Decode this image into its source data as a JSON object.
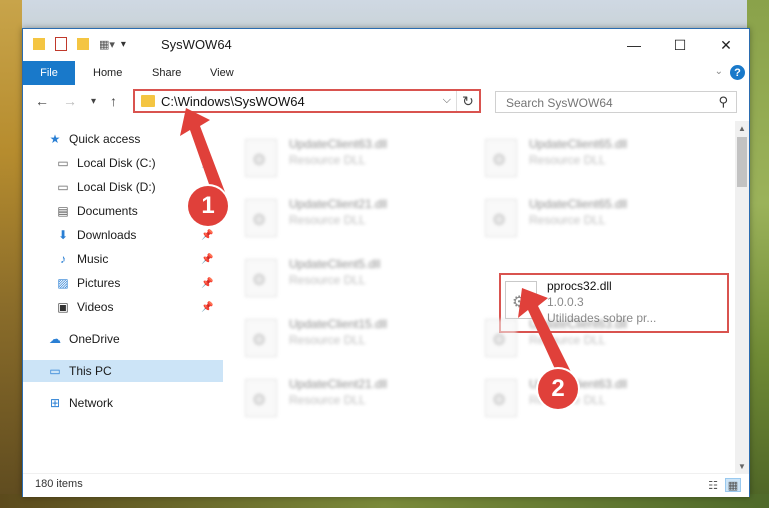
{
  "window": {
    "title": "SysWOW64",
    "minimize": "—",
    "maximize": "☐",
    "close": "✕"
  },
  "ribbon": {
    "file": "File",
    "home": "Home",
    "share": "Share",
    "view": "View",
    "help": "?"
  },
  "nav": {
    "back": "←",
    "forward": "→",
    "recent": "▾",
    "up": "↑",
    "address": "C:\\Windows\\SysWOW64",
    "dropdown": "⌵",
    "refresh": "↻",
    "search_placeholder": "Search SysWOW64",
    "search_icon": "⚲"
  },
  "sidebar": {
    "items": [
      {
        "label": "Quick access",
        "icon": "star-icon"
      },
      {
        "label": "Local Disk (C:)",
        "icon": "drive-icon"
      },
      {
        "label": "Local Disk (D:)",
        "icon": "drive-icon"
      },
      {
        "label": "Documents",
        "icon": "documents-icon"
      },
      {
        "label": "Downloads",
        "icon": "download-icon"
      },
      {
        "label": "Music",
        "icon": "music-icon"
      },
      {
        "label": "Pictures",
        "icon": "pictures-icon"
      },
      {
        "label": "Videos",
        "icon": "videos-icon"
      },
      {
        "label": "OneDrive",
        "icon": "cloud-icon"
      },
      {
        "label": "This PC",
        "icon": "computer-icon"
      },
      {
        "label": "Network",
        "icon": "network-icon"
      }
    ]
  },
  "files": [
    {
      "name": "UpdateClient63.dll",
      "desc": "Resource DLL"
    },
    {
      "name": "UpdateClient65.dll",
      "desc": "Resource DLL"
    },
    {
      "name": "UpdateClient21.dll",
      "desc": "Resource DLL"
    },
    {
      "name": "UpdateClient65.dll",
      "desc": "Resource DLL"
    },
    {
      "name": "UpdateClient5.dll",
      "desc": "Resource DLL"
    },
    {
      "name": "pprocs32.dll",
      "version": "1.0.0.3",
      "desc": "Utilidades sobre pr..."
    },
    {
      "name": "UpdateClient15.dll",
      "desc": "Resource DLL"
    },
    {
      "name": "UpdateClient63.dll",
      "desc": "Resource DLL"
    },
    {
      "name": "UpdateClient21.dll",
      "desc": "Resource DLL"
    },
    {
      "name": "UpdateClient63.dll",
      "desc": "Resource DLL"
    }
  ],
  "status": {
    "count": "180 items"
  },
  "annotations": {
    "step1": "1",
    "step2": "2",
    "color": "#e0403a"
  },
  "colors": {
    "accent": "#1979ca",
    "highlight": "#d9534f",
    "selected_nav": "#cce4f7"
  }
}
